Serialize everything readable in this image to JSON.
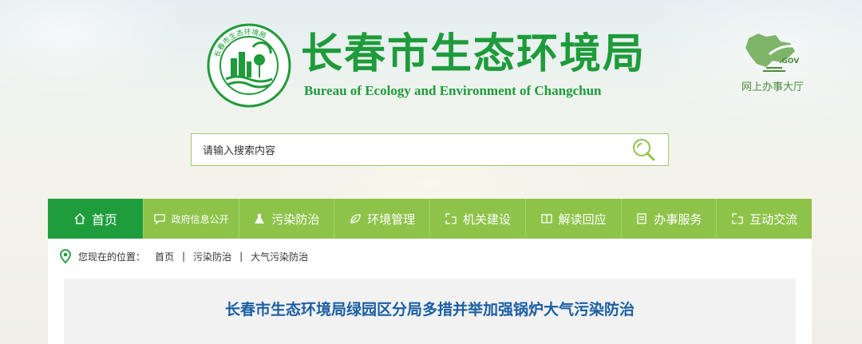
{
  "header": {
    "title": "长春市生态环境局",
    "subtitle": "Bureau of Ecology and Environment of Changchun",
    "logo_icon": "bureau-emblem-icon",
    "service_hall_label": "网上办事大厅",
    "service_hall_icon": "gov-map-icon"
  },
  "search": {
    "placeholder": "请输入搜索内容",
    "value": "",
    "button_icon": "search-icon"
  },
  "nav": {
    "items": [
      {
        "label": "首页",
        "icon": "home-icon",
        "active": true
      },
      {
        "label": "政府信息公开",
        "icon": "chat-icon"
      },
      {
        "label": "污染防治",
        "icon": "flask-icon"
      },
      {
        "label": "环境管理",
        "icon": "leaf-icon"
      },
      {
        "label": "机关建设",
        "icon": "link-icon"
      },
      {
        "label": "解读回应",
        "icon": "book-icon"
      },
      {
        "label": "办事服务",
        "icon": "document-icon"
      },
      {
        "label": "互动交流",
        "icon": "link-icon"
      }
    ]
  },
  "breadcrumb": {
    "prefix": "您现在的位置：",
    "items": [
      "首页",
      "污染防治",
      "大气污染防治"
    ],
    "separator": "|",
    "icon": "location-pin-icon"
  },
  "article": {
    "title": "长春市生态环境局绿园区分局多措并举加强锅炉大气污染防治"
  },
  "colors": {
    "brand_green": "#1e9b3a",
    "nav_green": "#8ec34a",
    "nav_active": "#1f9d3d",
    "article_title": "#1b5fa3"
  }
}
